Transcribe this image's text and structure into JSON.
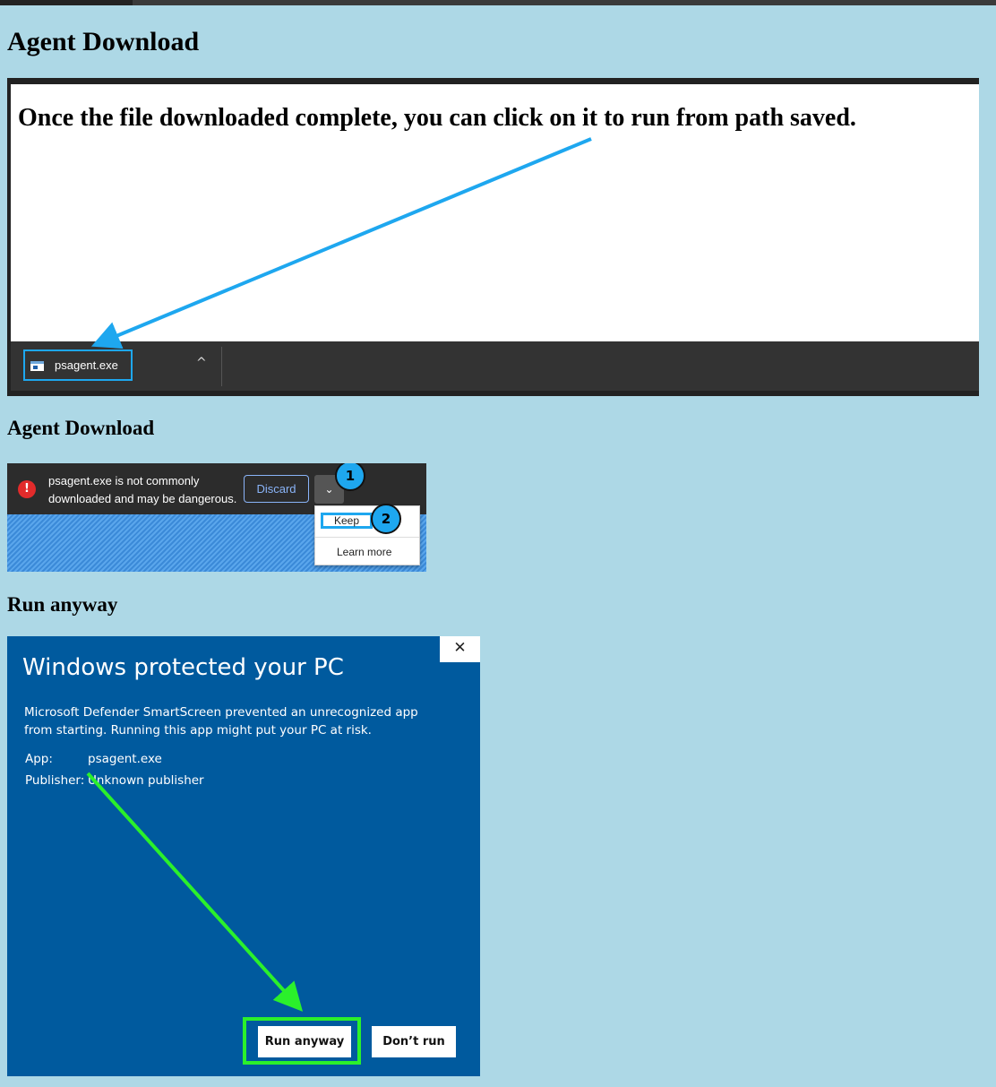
{
  "page": {
    "title": "Agent Download",
    "section2_title": "Agent Download",
    "section3_title": "Run anyway"
  },
  "panel1": {
    "message": "Once the file downloaded complete, you can click on it to run from path saved.",
    "download_item": {
      "file_name": "psagent.exe",
      "icon": "exe-file-icon",
      "caret": "^"
    }
  },
  "panel2": {
    "warning_text": "psagent.exe is not commonly downloaded and may be dangerous.",
    "warning_icon": "!",
    "discard_label": "Discard",
    "chevron": "⌄",
    "menu": {
      "keep_label": "Keep",
      "learn_more_label": "Learn more"
    },
    "badges": [
      "1",
      "2"
    ]
  },
  "panel3": {
    "title": "Windows protected your PC",
    "description": "Microsoft Defender SmartScreen prevented an unrecognized app from starting. Running this app might put your PC at risk.",
    "app_label": "App:",
    "app_value": "psagent.exe",
    "publisher_label": "Publisher:",
    "publisher_value": "Unknown publisher",
    "close_glyph": "✕",
    "run_anyway_label": "Run anyway",
    "dont_run_label": "Don’t run"
  },
  "colors": {
    "page_bg": "#add8e6",
    "highlight_blue": "#1ea7ef",
    "highlight_green": "#2bf02b",
    "smartscreen_blue": "#005a9e"
  }
}
